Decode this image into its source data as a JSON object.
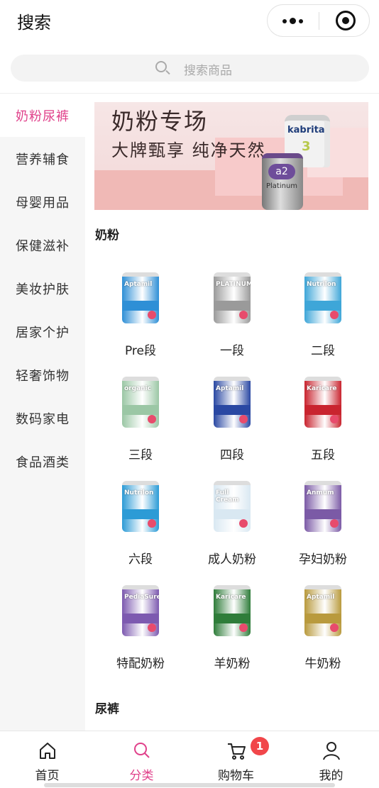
{
  "header": {
    "title": "搜索",
    "more_icon": "more-dots-icon",
    "target_icon": "record-target-icon"
  },
  "search": {
    "placeholder": "搜索商品",
    "icon": "search-icon"
  },
  "sidebar": {
    "items": [
      {
        "label": "奶粉尿裤",
        "active": true
      },
      {
        "label": "营养辅食",
        "active": false
      },
      {
        "label": "母婴用品",
        "active": false
      },
      {
        "label": "保健滋补",
        "active": false
      },
      {
        "label": "美妆护肤",
        "active": false
      },
      {
        "label": "居家个护",
        "active": false
      },
      {
        "label": "轻奢饰物",
        "active": false
      },
      {
        "label": "数码家电",
        "active": false
      },
      {
        "label": "食品酒类",
        "active": false
      }
    ],
    "active_color": "#e0408a"
  },
  "banner": {
    "title": "奶粉专场",
    "subtitle": "大牌甄享 纯净天然",
    "can1_brand": "kabrita",
    "can1_num": "3",
    "can2_brand": "a2",
    "can2_sub": "Platinum"
  },
  "sections": {
    "milk": "奶粉",
    "diaper": "尿裤"
  },
  "products": [
    {
      "label": "Pre段",
      "brand": "Aptamil",
      "color": "#2e8fd6"
    },
    {
      "label": "一段",
      "brand": "PLATINUM",
      "color": "#9a9a9a"
    },
    {
      "label": "二段",
      "brand": "Nutrilon",
      "color": "#3ea6d8"
    },
    {
      "label": "三段",
      "brand": "organic",
      "color": "#9bc7a5"
    },
    {
      "label": "四段",
      "brand": "Aptamil",
      "color": "#2a48a3"
    },
    {
      "label": "五段",
      "brand": "Karicare",
      "color": "#c9242f"
    },
    {
      "label": "六段",
      "brand": "Nutrilon",
      "color": "#2c9bd6"
    },
    {
      "label": "成人奶粉",
      "brand": "Full Cream",
      "color": "#d9e8f2"
    },
    {
      "label": "孕妇奶粉",
      "brand": "Anmum",
      "color": "#7b5aa6"
    },
    {
      "label": "特配奶粉",
      "brand": "PediaSure",
      "color": "#7d5ab0"
    },
    {
      "label": "羊奶粉",
      "brand": "Karicare",
      "color": "#2f7d3a"
    },
    {
      "label": "牛奶粉",
      "brand": "Aptamil",
      "color": "#b99a3d"
    }
  ],
  "tabbar": {
    "items": [
      {
        "label": "首页",
        "icon": "home-icon",
        "active": false
      },
      {
        "label": "分类",
        "icon": "category-search-icon",
        "active": true
      },
      {
        "label": "购物车",
        "icon": "cart-icon",
        "active": false
      },
      {
        "label": "我的",
        "icon": "user-icon",
        "active": false
      }
    ],
    "cart_badge": "1"
  }
}
